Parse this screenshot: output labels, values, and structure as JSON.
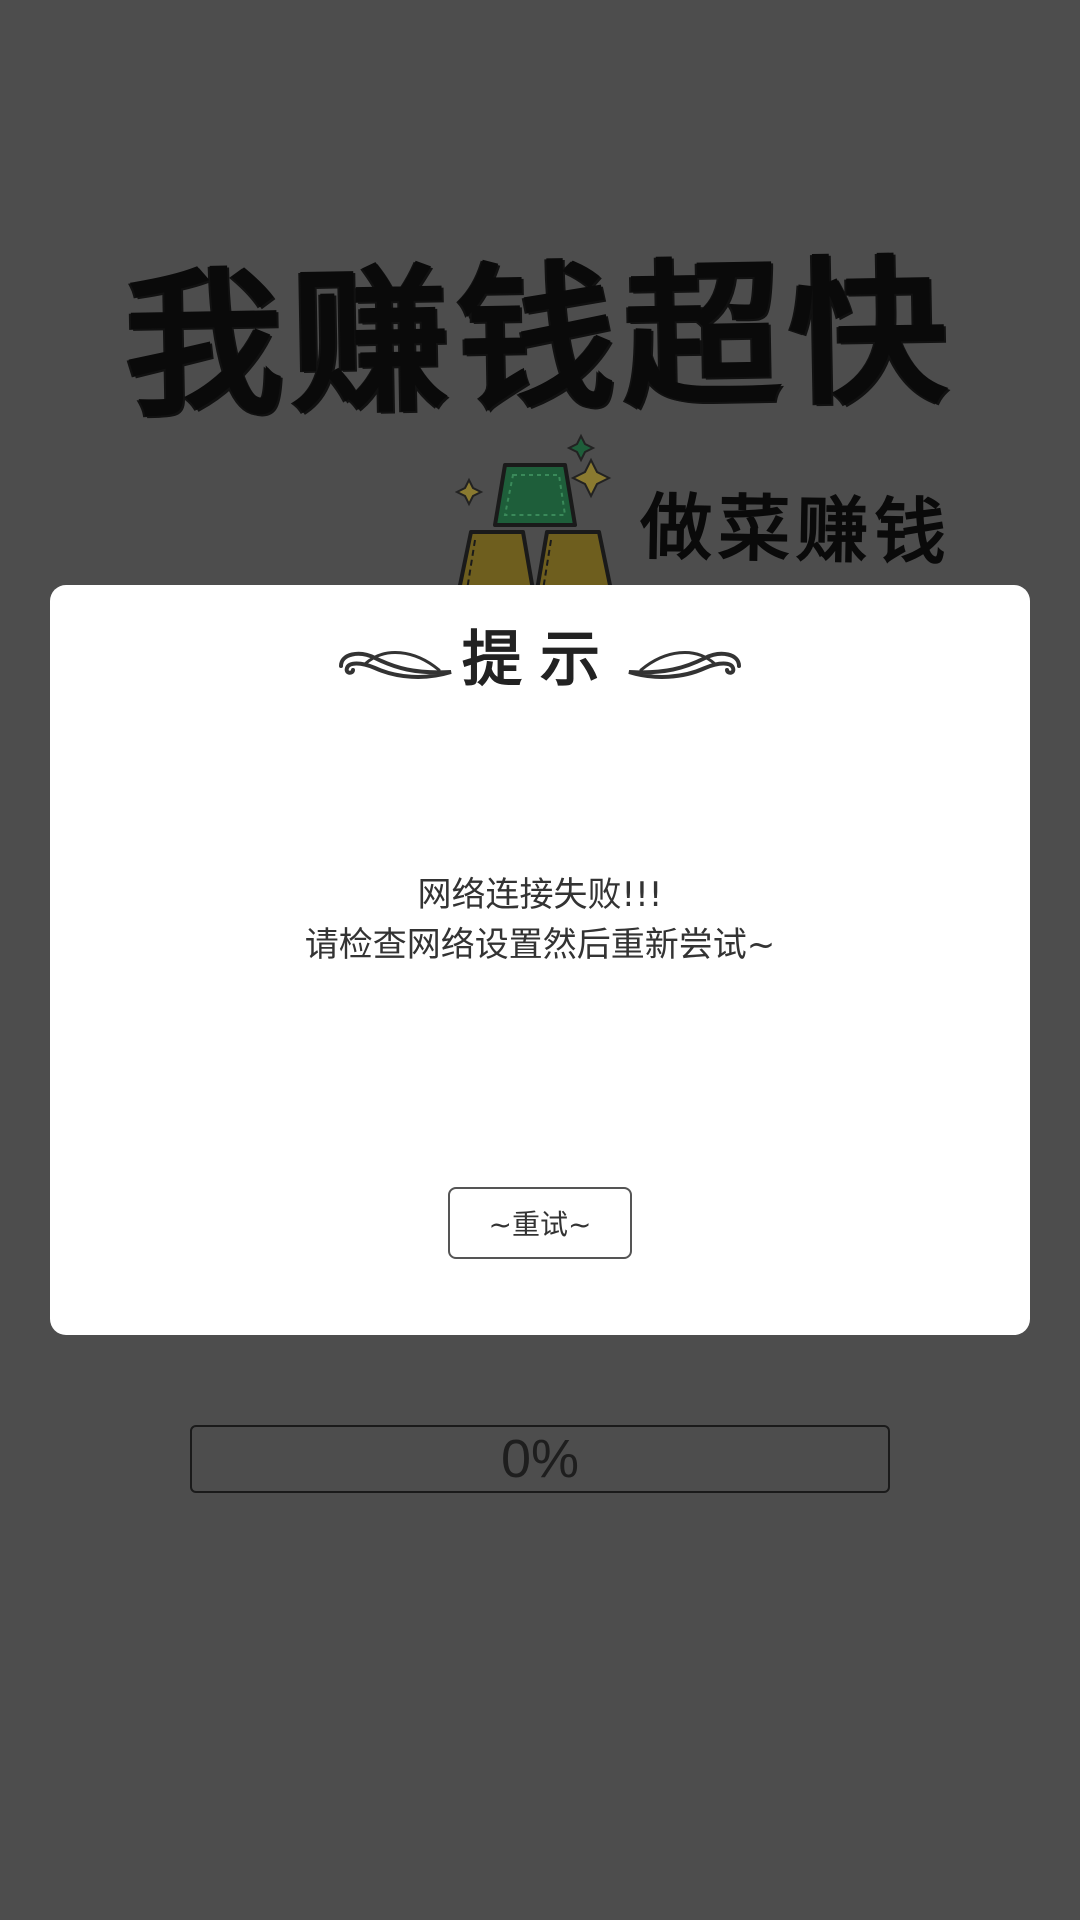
{
  "title": {
    "main": "我赚钱超快",
    "sub": "做菜赚钱"
  },
  "dialog": {
    "title": "提示",
    "message_line1": "网络连接失败!!!",
    "message_line2": "请检查网络设置然后重新尝试~",
    "retry_label": "~重试~"
  },
  "progress": {
    "value": 0,
    "label": "0%"
  },
  "colors": {
    "background": "#4d4d4d",
    "dialog_bg": "#ffffff",
    "text_dark": "#222222",
    "gold": "#8a7a30",
    "emerald": "#1e5e3a"
  }
}
